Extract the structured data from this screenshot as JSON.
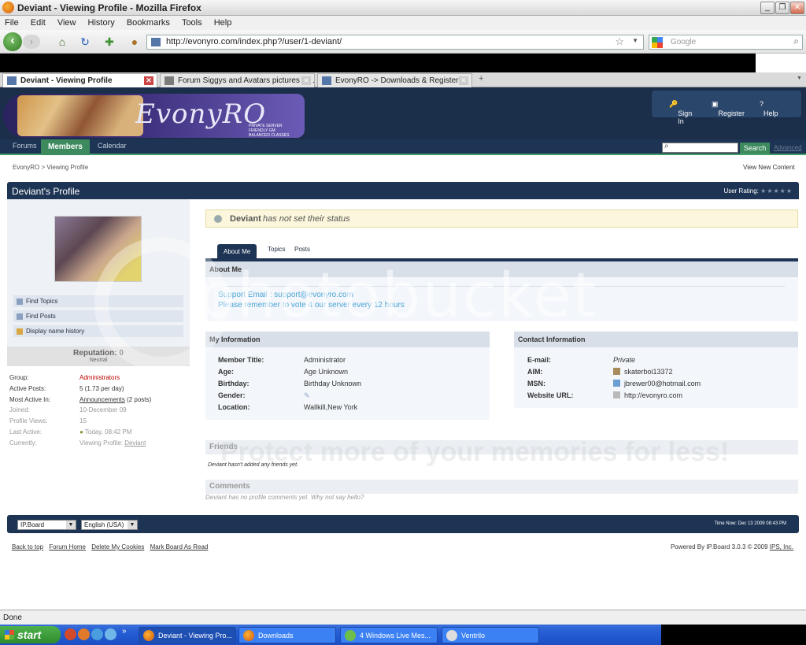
{
  "window": {
    "title": "Deviant - Viewing Profile - Mozilla Firefox",
    "buttons": [
      "_",
      "❐",
      "✕"
    ]
  },
  "menubar": [
    "File",
    "Edit",
    "View",
    "History",
    "Bookmarks",
    "Tools",
    "Help"
  ],
  "navbar": {
    "url": "http://evonyro.com/index.php?/user/1-deviant/",
    "search_placeholder": "Google"
  },
  "tabs": [
    {
      "label": "Deviant - Viewing Profile",
      "active": true
    },
    {
      "label": "Forum Siggys and Avatars pictures by ...",
      "active": false
    },
    {
      "label": "EvonyRO -> Downloads & Register",
      "active": false
    }
  ],
  "site": {
    "logo_text": "EvonyRO",
    "logo_tagline": [
      "Private Server",
      "Friendly GM",
      "Balanced Classes"
    ],
    "userlinks": {
      "sign_in": "Sign In",
      "register": "Register",
      "help": "Help"
    },
    "nav": {
      "forums": "Forums",
      "members": "Members",
      "calendar": "Calendar"
    },
    "search_button": "Search",
    "advanced": "Advanced",
    "breadcrumb": [
      "EvonyRO",
      ">",
      "Viewing Profile"
    ],
    "view_new_content": "View New Content"
  },
  "profile": {
    "title": "Deviant's Profile",
    "user_rating_label": "User Rating:",
    "user_rating_stars": "★★★★★",
    "left_menu": [
      "Find Topics",
      "Find Posts",
      "Display name history"
    ],
    "reputation": "Reputation: 0",
    "reputation_level": "Neutral",
    "stats": [
      {
        "k": "Group:",
        "v": "Administrators"
      },
      {
        "k": "Active Posts:",
        "v": "5 (1.73 per day)"
      },
      {
        "k": "Most Active In:",
        "v": "Announcements",
        "extra": " (2 posts)"
      },
      {
        "k": "Joined:",
        "v": "10-December 09"
      },
      {
        "k": "Profile Views:",
        "v": "15"
      },
      {
        "k": "Last Active:",
        "v": "Today, 08:42 PM"
      },
      {
        "k": "Currently:",
        "v": "Viewing Profile: ",
        "link": "Deviant"
      }
    ],
    "status_name": "Deviant",
    "status_text": "has not set their status",
    "tabs": [
      "About Me",
      "Topics",
      "Posts"
    ],
    "about_me_title": "About Me",
    "about_me_lines": [
      "Support Email : support@evonyro.com",
      "Please remember to vote 4 our server every 12 hours"
    ],
    "my_info_title": "My Information",
    "my_info": [
      {
        "k": "Member Title:",
        "v": "Administrator"
      },
      {
        "k": "Age:",
        "v": "Age Unknown"
      },
      {
        "k": "Birthday:",
        "v": "Birthday Unknown"
      },
      {
        "k": "Gender:",
        "v": ""
      },
      {
        "k": "Location:",
        "v": "Wallkill,New York"
      }
    ],
    "contact_title": "Contact Information",
    "contact": [
      {
        "k": "E-mail:",
        "v": "Private"
      },
      {
        "k": "AIM:",
        "v": "skaterboi13372"
      },
      {
        "k": "MSN:",
        "v": "jbrewer00@hotmail.com"
      },
      {
        "k": "Website URL:",
        "v": "http://evonyro.com"
      }
    ],
    "friends_title": "Friends",
    "friends_text": "Deviant hasn't added any friends yet.",
    "comments_title": "Comments",
    "comments_text": "Deviant has no profile comments yet. Why not say hello?"
  },
  "footer": {
    "skin": "IP.Board",
    "language": "English (USA)",
    "time_now": "Time Now: Dec 13 2009 08:43 PM",
    "links": [
      "Back to top",
      "Forum Home",
      "Delete My Cookies",
      "Mark Board As Read"
    ],
    "powered_prefix": "Powered By IP.Board 3.0.3 © 2009 ",
    "powered_link": "IPS, Inc."
  },
  "watermark": {
    "main": "photobucket",
    "sub": "Protect more of your memories for less!"
  },
  "statusbar": "Done",
  "taskbar": {
    "start": "start",
    "tasks": [
      "Deviant - Viewing Pro...",
      "Downloads",
      "Windows Live Mes...",
      "Ventrilo"
    ],
    "windows_live_count": "4"
  },
  "colors": {
    "header": "#1b2e4a",
    "accent_green": "#3d8a5e",
    "link_blue": "#4aa5d6",
    "admin_red": "#b00"
  }
}
